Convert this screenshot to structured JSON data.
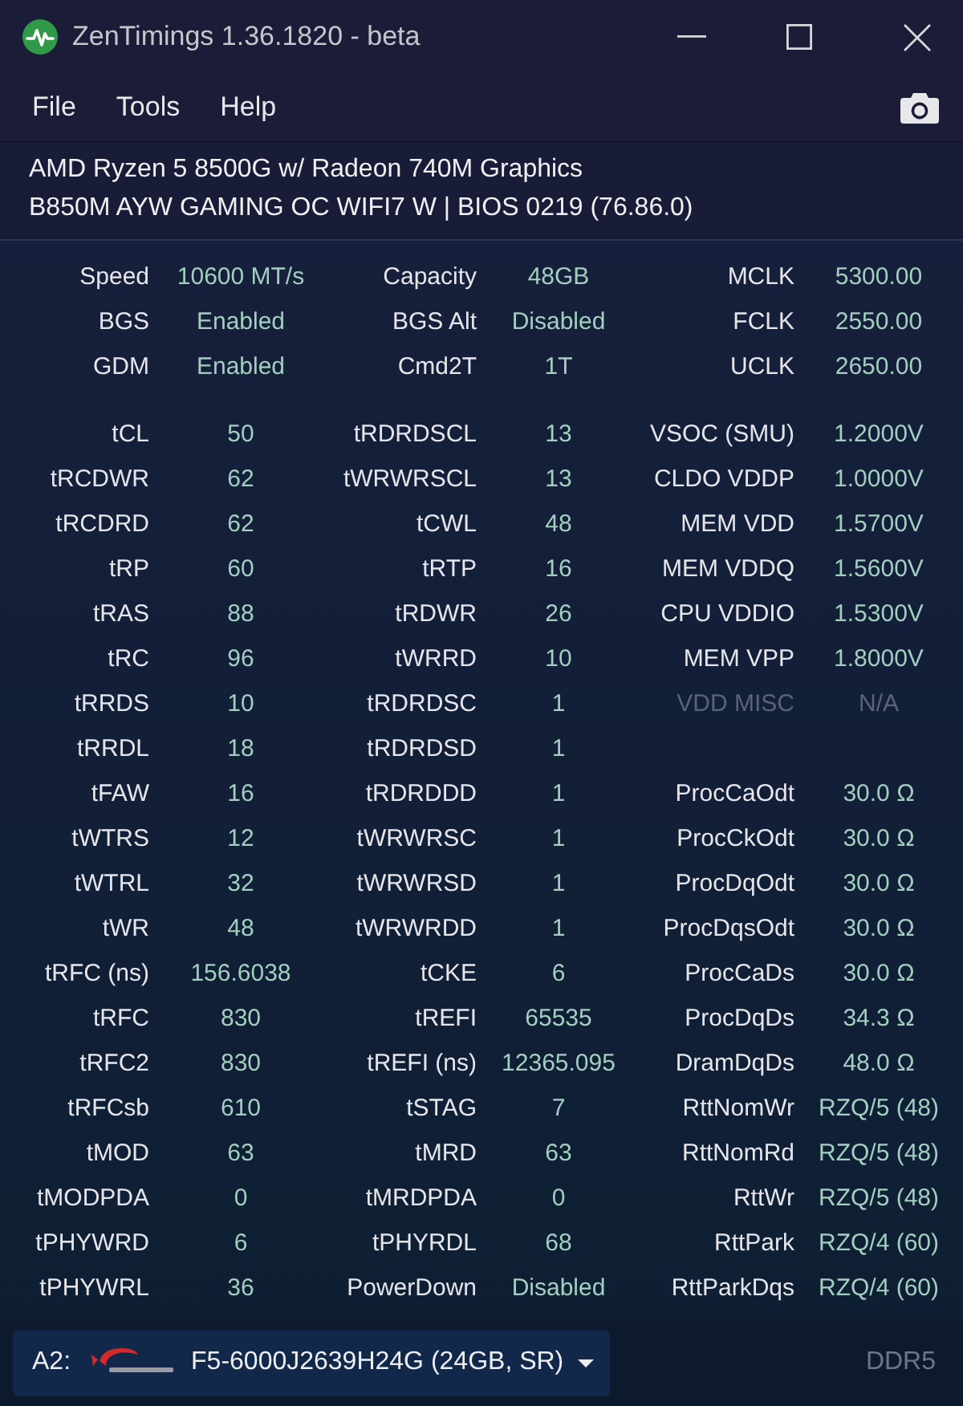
{
  "window": {
    "title": "ZenTimings 1.36.1820 - beta"
  },
  "menu": [
    "File",
    "Tools",
    "Help"
  ],
  "system_info": [
    "AMD Ryzen 5 8500G w/ Radeon 740M Graphics",
    "B850M AYW GAMING OC WIFI7 W | BIOS 0219 (76.86.0)"
  ],
  "summary": {
    "column_1": [
      {
        "label": "Speed",
        "value": "10600 MT/s"
      },
      {
        "label": "BGS",
        "value": "Enabled"
      },
      {
        "label": "GDM",
        "value": "Enabled"
      }
    ],
    "column_2": [
      {
        "label": "Capacity",
        "value": "48GB"
      },
      {
        "label": "BGS Alt",
        "value": "Disabled"
      },
      {
        "label": "Cmd2T",
        "value": "1T"
      }
    ],
    "column_3": [
      {
        "label": "MCLK",
        "value": "5300.00"
      },
      {
        "label": "FCLK",
        "value": "2550.00"
      },
      {
        "label": "UCLK",
        "value": "2650.00"
      }
    ]
  },
  "timings": {
    "column_1": [
      {
        "label": "tCL",
        "value": "50"
      },
      {
        "label": "tRCDWR",
        "value": "62"
      },
      {
        "label": "tRCDRD",
        "value": "62"
      },
      {
        "label": "tRP",
        "value": "60"
      },
      {
        "label": "tRAS",
        "value": "88"
      },
      {
        "label": "tRC",
        "value": "96"
      },
      {
        "label": "tRRDS",
        "value": "10"
      },
      {
        "label": "tRRDL",
        "value": "18"
      },
      {
        "label": "tFAW",
        "value": "16"
      },
      {
        "label": "tWTRS",
        "value": "12"
      },
      {
        "label": "tWTRL",
        "value": "32"
      },
      {
        "label": "tWR",
        "value": "48"
      },
      {
        "label": "tRFC (ns)",
        "value": "156.6038"
      },
      {
        "label": "tRFC",
        "value": "830"
      },
      {
        "label": "tRFC2",
        "value": "830"
      },
      {
        "label": "tRFCsb",
        "value": "610"
      },
      {
        "label": "tMOD",
        "value": "63"
      },
      {
        "label": "tMODPDA",
        "value": "0"
      },
      {
        "label": "tPHYWRD",
        "value": "6"
      },
      {
        "label": "tPHYWRL",
        "value": "36"
      }
    ],
    "column_2": [
      {
        "label": "tRDRDSCL",
        "value": "13"
      },
      {
        "label": "tWRWRSCL",
        "value": "13"
      },
      {
        "label": "tCWL",
        "value": "48"
      },
      {
        "label": "tRTP",
        "value": "16"
      },
      {
        "label": "tRDWR",
        "value": "26"
      },
      {
        "label": "tWRRD",
        "value": "10"
      },
      {
        "label": "tRDRDSC",
        "value": "1"
      },
      {
        "label": "tRDRDSD",
        "value": "1"
      },
      {
        "label": "tRDRDDD",
        "value": "1"
      },
      {
        "label": "tWRWRSC",
        "value": "1"
      },
      {
        "label": "tWRWRSD",
        "value": "1"
      },
      {
        "label": "tWRWRDD",
        "value": "1"
      },
      {
        "label": "tCKE",
        "value": "6"
      },
      {
        "label": "tREFI",
        "value": "65535"
      },
      {
        "label": "tREFI (ns)",
        "value": "12365.095"
      },
      {
        "label": "tSTAG",
        "value": "7"
      },
      {
        "label": "tMRD",
        "value": "63"
      },
      {
        "label": "tMRDPDA",
        "value": "0"
      },
      {
        "label": "tPHYRDL",
        "value": "68"
      },
      {
        "label": "PowerDown",
        "value": "Disabled"
      }
    ],
    "column_3_top": [
      {
        "label": "VSOC (SMU)",
        "value": "1.2000V",
        "disabled": false
      },
      {
        "label": "CLDO VDDP",
        "value": "1.0000V",
        "disabled": false
      },
      {
        "label": "MEM VDD",
        "value": "1.5700V",
        "disabled": false
      },
      {
        "label": "MEM VDDQ",
        "value": "1.5600V",
        "disabled": false
      },
      {
        "label": "CPU VDDIO",
        "value": "1.5300V",
        "disabled": false
      },
      {
        "label": "MEM VPP",
        "value": "1.8000V",
        "disabled": false
      },
      {
        "label": "VDD MISC",
        "value": "N/A",
        "disabled": true
      }
    ],
    "column_3_bottom": [
      {
        "label": "ProcCaOdt",
        "value": "30.0 Ω"
      },
      {
        "label": "ProcCkOdt",
        "value": "30.0 Ω"
      },
      {
        "label": "ProcDqOdt",
        "value": "30.0 Ω"
      },
      {
        "label": "ProcDqsOdt",
        "value": "30.0 Ω"
      },
      {
        "label": "ProcCaDs",
        "value": "30.0 Ω"
      },
      {
        "label": "ProcDqDs",
        "value": "34.3 Ω"
      },
      {
        "label": "DramDqDs",
        "value": "48.0 Ω"
      },
      {
        "label": "RttNomWr",
        "value": "RZQ/5 (48)"
      },
      {
        "label": "RttNomRd",
        "value": "RZQ/5 (48)"
      },
      {
        "label": "RttWr",
        "value": "RZQ/5 (48)"
      },
      {
        "label": "RttPark",
        "value": "RZQ/4 (60)"
      },
      {
        "label": "RttParkDqs",
        "value": "RZQ/4 (60)"
      }
    ]
  },
  "module_selector": {
    "slot": "A2:",
    "module": "F5-6000J2639H24G (24GB, SR)"
  },
  "memory_type": "DDR5"
}
